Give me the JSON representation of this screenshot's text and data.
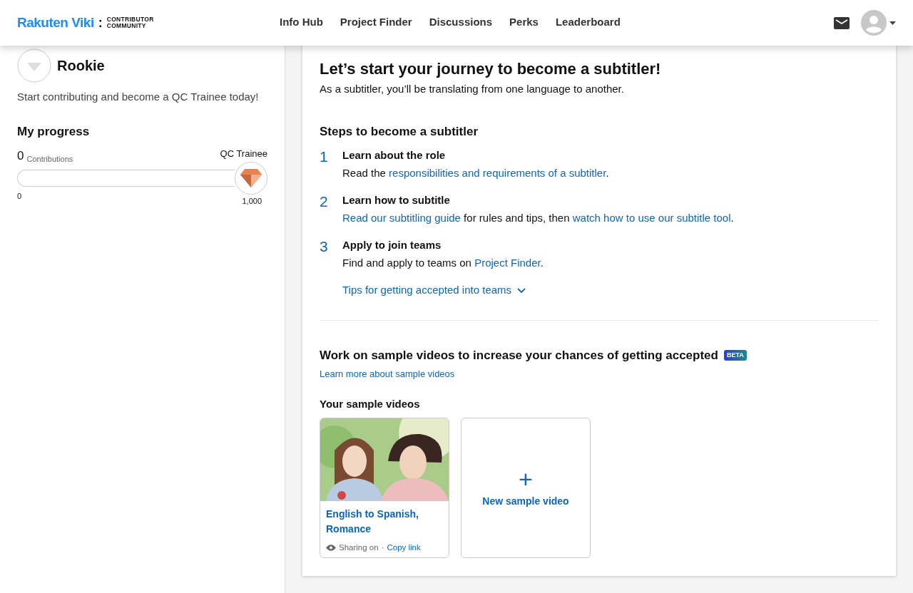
{
  "header": {
    "logo": {
      "brand": "Rakuten Viki",
      "separator": ":",
      "subtitle_line_1": "CONTRIBUTOR",
      "subtitle_line_2": "COMMUNITY"
    },
    "nav": [
      {
        "label": "Info Hub",
        "selected": false
      },
      {
        "label": "Project Finder",
        "selected": false
      },
      {
        "label": "Discussions",
        "selected": false
      },
      {
        "label": "Perks",
        "selected": false
      },
      {
        "label": "Leaderboard",
        "selected": false
      }
    ]
  },
  "sidebar": {
    "rank": "Rookie",
    "description": "Start contributing and become a QC Trainee today!",
    "progress": {
      "title": "My progress",
      "count": "0",
      "count_label": "Contributions",
      "goal_label": "QC Trainee",
      "level": 0,
      "min_label": "0",
      "max_label": "1,000"
    }
  },
  "main": {
    "title": "Let’s start your journey to become a subtitler!",
    "subtitle": "As a subtitler, you’ll be translating from one language to another.",
    "steps_title": "Steps to become a subtitler",
    "steps": [
      {
        "number": "1",
        "title": "Learn about the role",
        "text": [
          {
            "kind": "text",
            "text": "Read the "
          },
          {
            "kind": "link",
            "text": "responsibilities and requirements of a subtitler"
          },
          {
            "kind": "text",
            "text": "."
          }
        ]
      },
      {
        "number": "2",
        "title": "Learn how to subtitle",
        "text": [
          {
            "kind": "link",
            "text": "Read our subtitling guide"
          },
          {
            "kind": "text",
            "text": " for rules and tips, then "
          },
          {
            "kind": "link",
            "text": "watch how to use our subtitle tool"
          },
          {
            "kind": "text",
            "text": "."
          }
        ]
      },
      {
        "number": "3",
        "title": "Apply to join teams",
        "text": [
          {
            "kind": "text",
            "text": "Find and apply to teams on "
          },
          {
            "kind": "link",
            "text": "Project Finder"
          },
          {
            "kind": "text",
            "text": "."
          }
        ],
        "toggle": {
          "label": "Tips for getting accepted into teams",
          "expanded": false
        }
      }
    ],
    "samples": {
      "title": "Work on sample videos to increase your chances of getting accepted",
      "badge": "BETA",
      "learn_more": "Learn more about sample videos",
      "list_title": "Your sample videos",
      "videos": [
        {
          "title": "English to Spanish, Romance",
          "sharing": "Sharing on",
          "separator": "·",
          "copy_link": "Copy link"
        }
      ],
      "new_label": "New sample video",
      "new_icon": "+"
    }
  }
}
